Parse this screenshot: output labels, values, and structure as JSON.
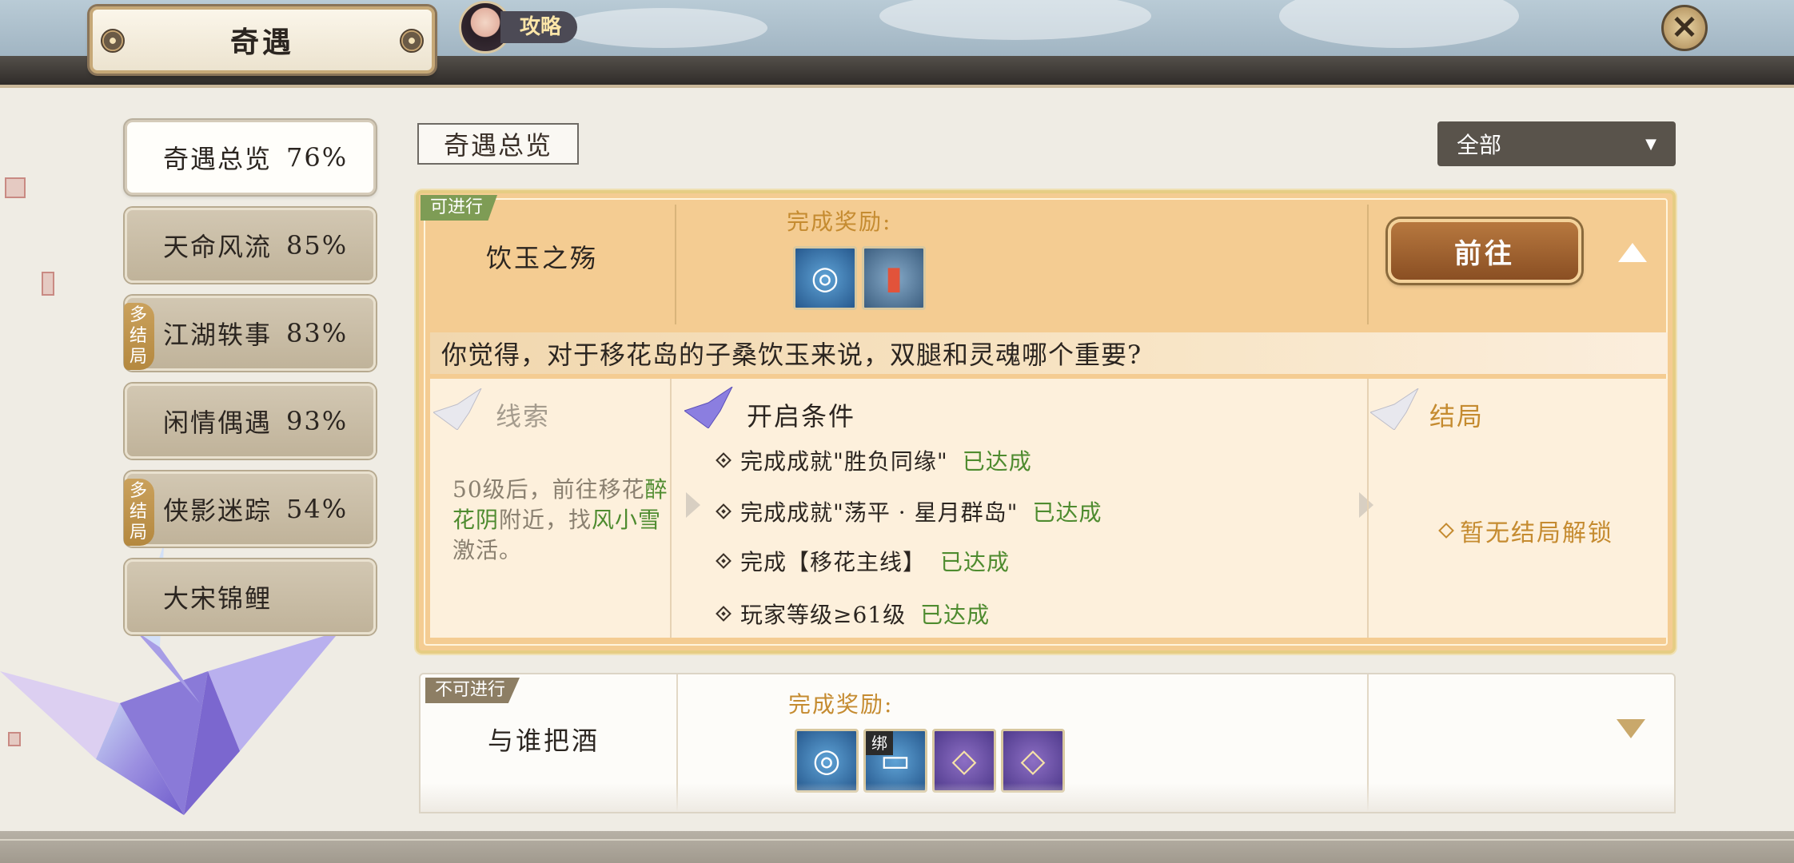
{
  "header": {
    "title": "奇遇",
    "guide_label": "攻略",
    "close_glyph": "✕"
  },
  "sidebar": {
    "categories": [
      {
        "label": "奇遇总览",
        "pct": "76%",
        "active": true,
        "tag": ""
      },
      {
        "label": "天命风流",
        "pct": "85%",
        "active": false,
        "tag": ""
      },
      {
        "label": "江湖轶事",
        "pct": "83%",
        "active": false,
        "tag": "多结局"
      },
      {
        "label": "闲情偶遇",
        "pct": "93%",
        "active": false,
        "tag": ""
      },
      {
        "label": "侠影迷踪",
        "pct": "54%",
        "active": false,
        "tag": "多结局"
      },
      {
        "label": "大宋锦鲤",
        "pct": "",
        "active": false,
        "tag": ""
      }
    ]
  },
  "main": {
    "section_title": "奇遇总览",
    "filter": {
      "selected": "全部"
    }
  },
  "quests": [
    {
      "status": "可进行",
      "name": "饮玉之殇",
      "reward_label": "完成奖励:",
      "rewards": [
        {
          "icon": "coin-token-icon",
          "color": "blue",
          "badge": ""
        },
        {
          "icon": "firecracker-icon",
          "color": "red",
          "badge": ""
        }
      ],
      "go_label": "前往",
      "question": "你觉得，对于移花岛的子桑饮玉来说，双腿和灵魂哪个重要?",
      "clue_title": "线索",
      "clue_text_1": "50级后，前往移花",
      "clue_place": "醉花阴",
      "clue_text_2": "附近，找",
      "clue_npc": "风小雪",
      "clue_text_3": "激活。",
      "cond_title": "开启条件",
      "conditions": [
        {
          "text": "完成成就\"胜负同缘\"",
          "state": "已达成"
        },
        {
          "text": "完成成就\"荡平 · 星月群岛\"",
          "state": "已达成"
        },
        {
          "text": "完成【移花主线】",
          "state": "已达成"
        },
        {
          "text": "玩家等级≥61级",
          "state": "已达成"
        }
      ],
      "ending_title": "结局",
      "ending_text": "暂无结局解锁"
    },
    {
      "status": "不可进行",
      "name": "与谁把酒",
      "reward_label": "完成奖励:",
      "rewards": [
        {
          "icon": "coin-token-icon",
          "color": "blue",
          "badge": ""
        },
        {
          "icon": "bound-ticket-icon",
          "color": "blue",
          "badge": "绑"
        },
        {
          "icon": "favor-gift-icon",
          "color": "purple",
          "badge": ""
        },
        {
          "icon": "favor-gift-icon",
          "color": "purple",
          "badge": ""
        }
      ]
    }
  ],
  "colors": {
    "accent_gold": "#c58b30",
    "achieved_green": "#4e8b2f",
    "card_active_bg": "#f4cc92",
    "tag_gold": "#b4883f"
  }
}
